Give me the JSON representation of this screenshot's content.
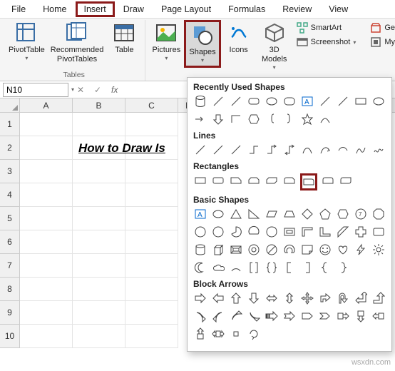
{
  "tabs": {
    "file": "File",
    "home": "Home",
    "insert": "Insert",
    "draw": "Draw",
    "pagelayout": "Page Layout",
    "formulas": "Formulas",
    "review": "Review",
    "view": "View"
  },
  "ribbon": {
    "tables": {
      "pivottable": "PivotTable",
      "recommended": "Recommended\nPivotTables",
      "table": "Table",
      "label": "Tables"
    },
    "illustrations": {
      "pictures": "Pictures",
      "shapes": "Shapes",
      "icons": "Icons",
      "models": "3D\nModels",
      "smartart": "SmartArt",
      "screenshot": "Screenshot",
      "my": "My"
    },
    "right": {
      "get": "Ge"
    }
  },
  "namebox": "N10",
  "fx": "fx",
  "columns": [
    "A",
    "B",
    "C",
    "D"
  ],
  "rows": [
    "1",
    "2",
    "3",
    "4",
    "5",
    "6",
    "7",
    "8",
    "9",
    "10"
  ],
  "title_text": "How to Draw Is",
  "shapes_panel": {
    "recent": "Recently Used Shapes",
    "lines": "Lines",
    "rectangles": "Rectangles",
    "basic": "Basic Shapes",
    "block": "Block Arrows"
  },
  "watermark": "wsxdn.com"
}
